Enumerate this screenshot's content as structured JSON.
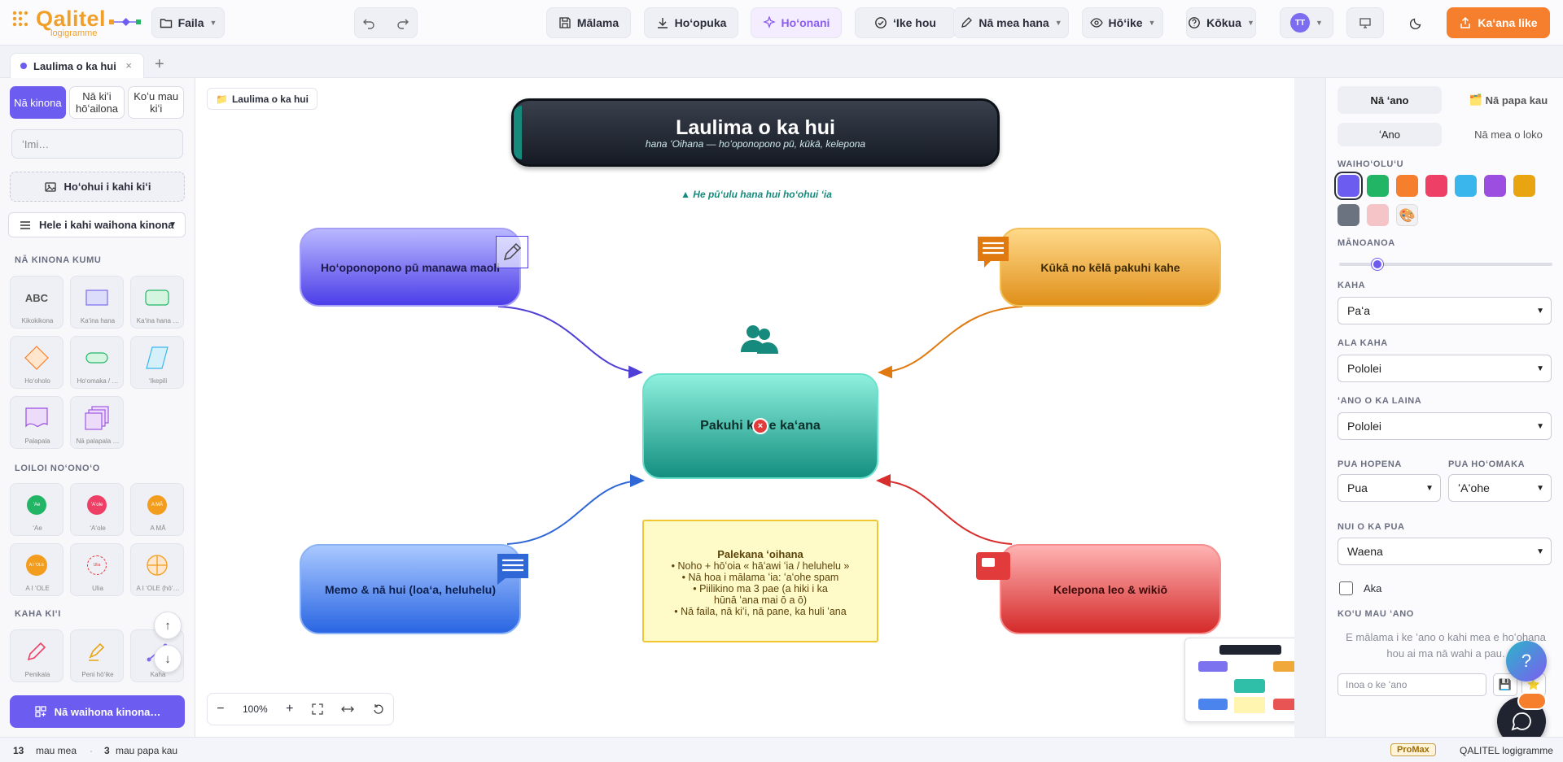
{
  "brand": {
    "name": "Qalitel",
    "sub": "logigramme"
  },
  "toolbar": {
    "file": "Faila",
    "save": "Mālama",
    "download": "Hoʻopuka",
    "present": "Hoʻonani",
    "check": "ʻIke hou",
    "edit": "Nā mea hana",
    "view": "Hōʻike",
    "help": "Kōkua",
    "avatar": "TT",
    "share": "Kaʻana like"
  },
  "tab": {
    "label": "Laulima o ka hui",
    "close": "×",
    "add": "+"
  },
  "sidebar": {
    "seg": [
      "Nā kinona",
      "Nā kiʻi hōʻailona",
      "Koʻu mau kiʻi"
    ],
    "search_placeholder": "ʻImi…",
    "upload": "Hoʻohui i kahi kiʻi",
    "library": "Hele i kahi waihona kinona",
    "sections": [
      "NĀ KINONA KUMU",
      "LOILOI NOʻONOʻO",
      "KAHA KIʻI"
    ],
    "basic": [
      {
        "label": "Kikokikona",
        "glyph": "ABC"
      },
      {
        "label": "Kaʻina hana"
      },
      {
        "label": "Kaʻina hana …"
      },
      {
        "label": "Hoʻoholo"
      },
      {
        "label": "Hoʻomaka / …"
      },
      {
        "label": "ʻIkepili"
      },
      {
        "label": "Palapala"
      },
      {
        "label": "Nā palapala …"
      }
    ],
    "logic": [
      {
        "label": "ʻAe",
        "glyph": "ʻAe",
        "color": "#22b565"
      },
      {
        "label": "ʻAʻole",
        "glyph": "ʻAʻole",
        "color": "#ee4066"
      },
      {
        "label": "A MĀ",
        "glyph": "A MĀ",
        "color": "#f29d1e"
      },
      {
        "label": "A I ʻOLE",
        "glyph": "A I ʻOLE",
        "color": "#f29d1e"
      },
      {
        "label": "Ulia",
        "glyph": "Ulia",
        "color": "#e23b3b"
      },
      {
        "label": "A I ʻOLE (hōʻ…",
        "color": "#f29d1e"
      }
    ],
    "draw": [
      {
        "label": "Penikala"
      },
      {
        "label": "Peni hōʻike"
      },
      {
        "label": "Kaha"
      }
    ],
    "more": "Nā waihona kinona…",
    "up": "↑",
    "down": "↓"
  },
  "canvas": {
    "breadcrumb": "Laulima o ka hui",
    "title": "Laulima o ka hui",
    "subtitle": "hana ʻOihana — hoʻoponopono pū, kūkā, kelepona",
    "hint": "▲ He pūʻulu hana hui hoʻohui ʻia",
    "nodes": {
      "tl": "Hoʻoponopono pū manawa maoli",
      "tr": "Kūkā no kēlā pakuhi kahe",
      "center": "Pakuhi kahe kaʻana",
      "bl": "Memo & nā hui (loaʻa, heluhelu)",
      "br": "Kelepona leo & wikiō"
    },
    "note": {
      "title": "Palekana ʻoihana",
      "lines": [
        "• Noho + hōʻoia « hāʻawi ʻia / heluhelu »",
        "• Nā hoa i mālama ʻia: ʻaʻohe spam",
        "• Piilikino ma 3 pae (a hiki i ka",
        "hūnā ʻana mai ō a ō)",
        "• Nā faila, nā kiʻi, nā pane, ka huli ʻana"
      ]
    },
    "zoom": "100%"
  },
  "panel": {
    "tabs": [
      "Nā ʻano",
      "Nā papa kau"
    ],
    "subtabs": [
      "ʻAno",
      "Nā mea o loko"
    ],
    "labels": {
      "color": "WAIHOʻOLUʻU",
      "opacity": "MĀNOANOA",
      "stroke": "KAHA",
      "strokepath": "ALA KAHA",
      "linetype": "ʻANO O KA LAINA",
      "endarrow": "PUA HOPENA",
      "startarrow": "PUA HOʻOMAKA",
      "arrowsize": "NUI O KA PUA",
      "mystyles": "KOʻU MAU ʻANO"
    },
    "values": {
      "stroke": "Paʻa",
      "strokepath": "Pololei",
      "linetype": "Pololei",
      "endarrow": "Pua",
      "startarrow": "ʻAʻohe",
      "arrowsize": "Waena",
      "shadow": "Aka"
    },
    "opacity_level": 0.16,
    "styles_hint": "E mālama i ke ʻano o kahi mea e hoʻohana hou ai ma nā wahi a pau.",
    "style_name_placeholder": "Inoa o ke ʻano",
    "swatches": [
      "#6d5cf0",
      "#22b565",
      "#f57f2c",
      "#ee4066",
      "#3bb6ec",
      "#9b4ee0",
      "#e8a511",
      "#6b7280",
      "#f5c4c6"
    ]
  },
  "status": {
    "items_count": "13",
    "items_label": "mau mea",
    "layers_count": "3",
    "layers_label": "mau papa kau",
    "plan": "ProMax",
    "app": "QALITEL logigramme"
  },
  "help": "?"
}
